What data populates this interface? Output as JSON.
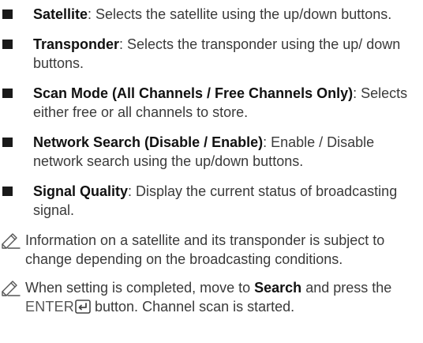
{
  "items": [
    {
      "term": "Satellite",
      "text": ": Selects the satellite using the up/down buttons."
    },
    {
      "term": "Transponder",
      "text": ": Selects the transponder using the up/ down buttons."
    },
    {
      "term": "Scan Mode (All Channels / Free Channels Only)",
      "text": ": Selects either free or all channels to store."
    },
    {
      "term": "Network Search (Disable / Enable)",
      "text": ": Enable / Disable network search using the up/down buttons."
    },
    {
      "term": "Signal Quality",
      "text": ": Display the current status of broadcasting signal."
    }
  ],
  "notes": {
    "note1": "Information on a satellite and its transponder is subject to change depending on the broadcasting conditions.",
    "note2_a": "When setting is completed, move to ",
    "note2_search": "Search",
    "note2_b": " and press the ",
    "note2_enter": "ENTER",
    "note2_c": " button. Channel scan is started."
  },
  "icons": {
    "bullet": "square-bullet-icon",
    "note": "pencil-note-icon",
    "enter": "enter-key-icon"
  }
}
